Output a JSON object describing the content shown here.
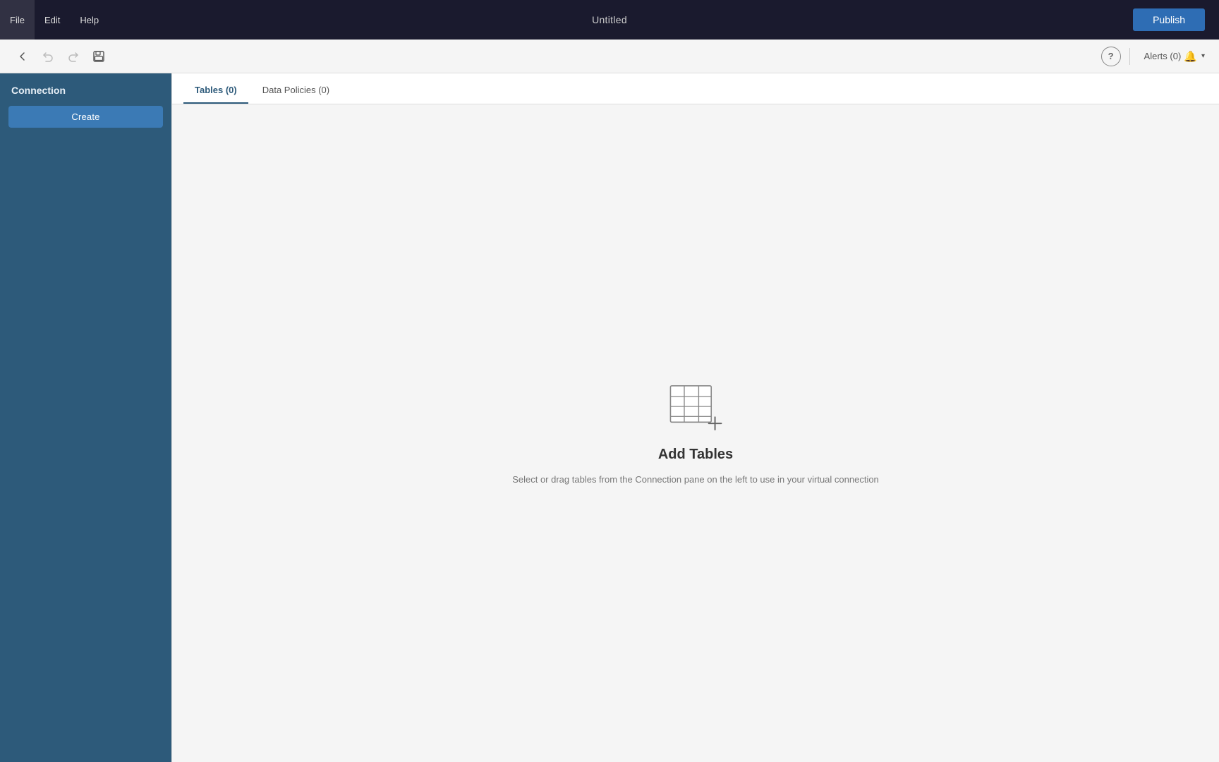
{
  "titlebar": {
    "title": "Untitled",
    "publish_label": "Publish"
  },
  "menu": {
    "file": "File",
    "edit": "Edit",
    "help": "Help"
  },
  "toolbar": {
    "undo_title": "Undo",
    "redo_title": "Redo",
    "save_title": "Save",
    "help_label": "?",
    "alerts_label": "Alerts (0)",
    "collapse_title": "Collapse sidebar"
  },
  "sidebar": {
    "title": "Connection",
    "create_label": "Create"
  },
  "tabs": [
    {
      "label": "Tables (0)",
      "active": true
    },
    {
      "label": "Data Policies (0)",
      "active": false
    }
  ],
  "empty_state": {
    "title": "Add Tables",
    "description": "Select or drag tables from the Connection pane on the left to use in your virtual connection"
  }
}
